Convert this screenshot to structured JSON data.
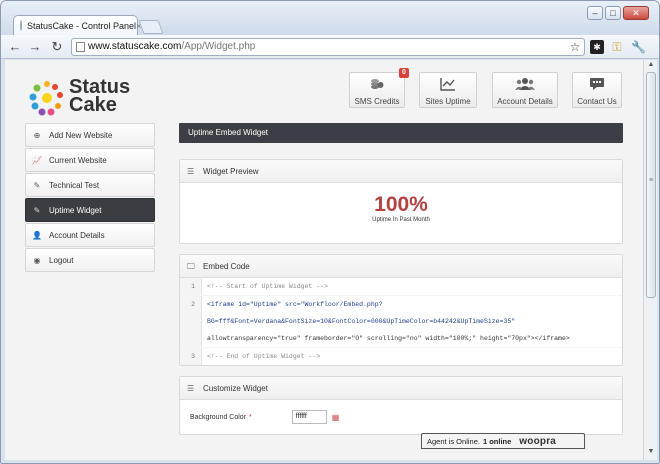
{
  "browser": {
    "tab_title": "StatusCake - Control Panel",
    "tab_close": "×",
    "url_host": "www.statuscake.com",
    "url_path": "/App/Widget.php"
  },
  "logo": {
    "line1": "Status",
    "line2": "Cake"
  },
  "top_buttons": [
    {
      "label": "SMS Credits",
      "badge": "0",
      "icon": "coins-icon"
    },
    {
      "label": "Sites Uptime",
      "icon": "line-chart-icon"
    },
    {
      "label": "Account Details",
      "icon": "users-icon"
    },
    {
      "label": "Contact Us",
      "icon": "speech-bubble-icon"
    }
  ],
  "sidebar": {
    "items": [
      {
        "label": "Add New Website",
        "icon": "plug-icon"
      },
      {
        "label": "Current Website",
        "icon": "chart-icon"
      },
      {
        "label": "Technical Test",
        "icon": "pencil-icon"
      },
      {
        "label": "Uptime Widget",
        "icon": "pencil-icon",
        "active": true
      },
      {
        "label": "Account Details",
        "icon": "user-icon"
      },
      {
        "label": "Logout",
        "icon": "eye-icon"
      }
    ]
  },
  "main": {
    "page_title": "Uptime Embed Widget",
    "preview": {
      "heading": "Widget Preview",
      "value": "100%",
      "caption": "Uptime In Past Month",
      "value_color": "#b44242"
    },
    "embed": {
      "heading": "Embed Code",
      "lines": [
        {
          "num": "1",
          "text": "<!-- Start of Uptime Widget -->"
        },
        {
          "num": "2",
          "text_a": "<iframe id=\"Uptime\" src=\"Workfloor/Embed.php?",
          "text_b": "BG=fff&Font=Verdana&FontSize=10&FontColor=000&UpTimeColor=b44242&UpTimeSize=35\"",
          "text_c": "allowtransparency=\"true\" frameborder=\"0\" scrolling=\"no\" width=\"100%;\" height=\"70px\"></iframe>"
        },
        {
          "num": "3",
          "text": "<!-- End of Uptime Widget -->"
        }
      ]
    },
    "customize": {
      "heading": "Customize Widget",
      "bg_label": "Background Color",
      "required_mark": "*",
      "bg_value": "ffffff"
    }
  },
  "chat": {
    "status_text": "Agent is Online.",
    "count_text": "1 online",
    "brand": "woopra"
  },
  "colors": {
    "active_sidebar": "#3a3d42",
    "header_bar": "#3b3e44",
    "accent_red": "#b44242"
  }
}
